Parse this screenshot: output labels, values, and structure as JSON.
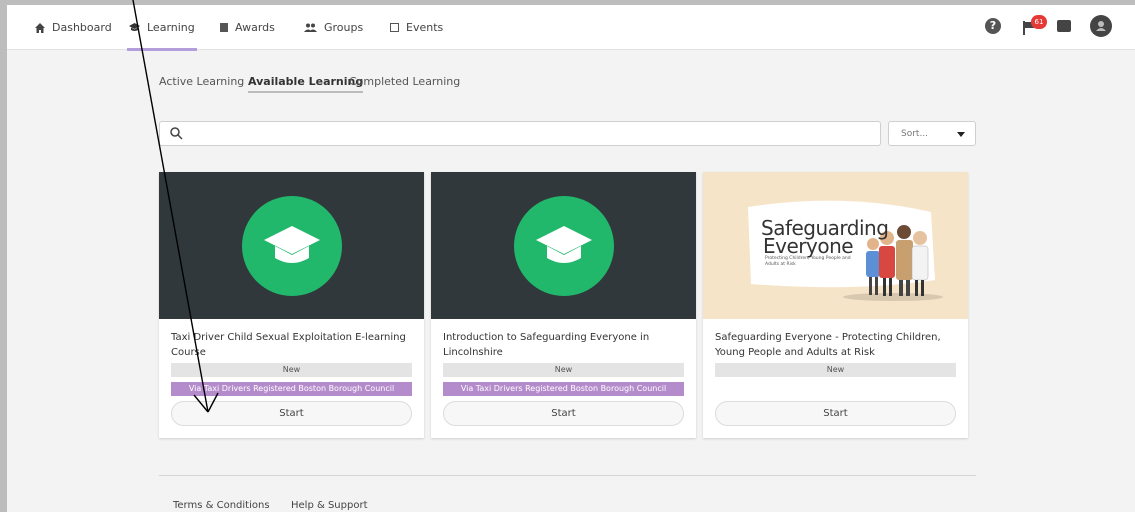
{
  "nav": {
    "items": [
      {
        "label": "Dashboard",
        "icon": "home-icon"
      },
      {
        "label": "Learning",
        "icon": "graduation-cap-icon"
      },
      {
        "label": "Awards",
        "icon": "book-icon"
      },
      {
        "label": "Groups",
        "icon": "people-icon"
      },
      {
        "label": "Events",
        "icon": "calendar-icon"
      }
    ],
    "notification_count": "61",
    "accent_color": "#b39ddb"
  },
  "subtabs": [
    "Active Learning",
    "Available Learning",
    "Completed Learning"
  ],
  "search": {
    "placeholder": ""
  },
  "sort": {
    "label": "Sort..."
  },
  "cards": [
    {
      "title": "Taxi Driver Child Sexual Exploitation E-learning Course",
      "badge_new": "New",
      "badge_via": "Via Taxi Drivers Registered Boston Borough Council",
      "button": "Start"
    },
    {
      "title": "Introduction to Safeguarding Everyone in Lincolnshire",
      "badge_new": "New",
      "badge_via": "Via Taxi Drivers Registered Boston Borough Council",
      "button": "Start"
    },
    {
      "title": "Safeguarding Everyone - Protecting Children, Young People and Adults at Risk",
      "badge_new": "New",
      "button": "Start",
      "image_text": {
        "line1": "Safeguarding",
        "line2": "Everyone",
        "sub": "Protecting Children, Young People and Adults at Risk"
      }
    }
  ],
  "footer": {
    "links": [
      "Terms & Conditions",
      "Help & Support"
    ]
  },
  "colors": {
    "course_green": "#21b86c",
    "card_dark": "#30383b",
    "via_purple": "#b58ccb",
    "badge_red": "#e53935"
  }
}
